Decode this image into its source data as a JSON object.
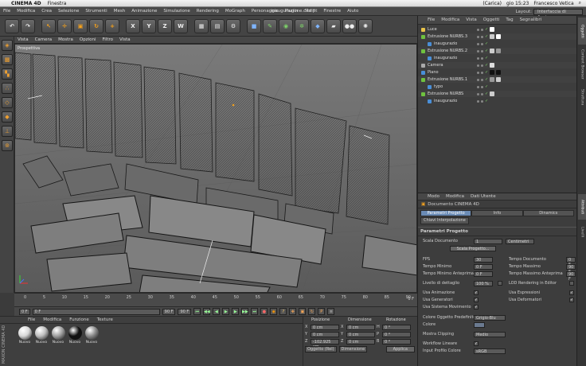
{
  "mac_menubar": {
    "app": "CINEMA 4D",
    "menu": "Finestra",
    "battery": "(Carica)",
    "clock": "gio 15:23",
    "user": "Francesco Vetica"
  },
  "window": {
    "title": "inaugurazione.c4d *"
  },
  "app_menu": [
    "File",
    "Modifica",
    "Crea",
    "Selezione",
    "Strumenti",
    "Mesh",
    "Animazione",
    "Simulazione",
    "Rendering",
    "MoGraph",
    "Personaggio",
    "Plugin",
    "Script",
    "Finestre",
    "Aiuto"
  ],
  "layout": {
    "label": "Layout:",
    "value": "Interfaccia di Avvio"
  },
  "toolbar": {
    "axis_x": "X",
    "axis_y": "Y",
    "axis_z": "Z",
    "world": "W"
  },
  "viewport": {
    "menu": [
      "Vista",
      "Camera",
      "Mostra",
      "Opzioni",
      "Filtro",
      "Vista"
    ],
    "label": "Prospettiva"
  },
  "timeline": {
    "ticks": [
      "0",
      "5",
      "10",
      "15",
      "20",
      "25",
      "30",
      "35",
      "40",
      "45",
      "50",
      "55",
      "60",
      "65",
      "70",
      "75",
      "80",
      "85",
      "90"
    ],
    "frame_end": "0 F"
  },
  "transport": {
    "start": "0 F",
    "current": "0 F",
    "end": "90 F",
    "end2": "90 F"
  },
  "material_panel": {
    "menu": [
      "File",
      "Modifica",
      "Funzione",
      "Texture"
    ],
    "brand": "MAXON CINEMA 4D",
    "materials": [
      {
        "name": "Nuovo",
        "color": "#d8d8d8"
      },
      {
        "name": "Nuovo",
        "color": "#bdbdbd"
      },
      {
        "name": "Nuovo",
        "color": "#a0a0a0"
      },
      {
        "name": "Nuovo",
        "color": "#111111"
      },
      {
        "name": "Nuovo",
        "color": "#8a8a8a"
      }
    ]
  },
  "coord_panel": {
    "headers": [
      "Posizione",
      "Dimensione",
      "Rotazione"
    ],
    "rows": [
      {
        "axis": "X",
        "pos": "0 cm",
        "dim": "0 cm",
        "rot_axis": "H",
        "rot": "0 °"
      },
      {
        "axis": "Y",
        "pos": "0 cm",
        "dim": "0 cm",
        "rot_axis": "P",
        "rot": "0 °"
      },
      {
        "axis": "Z",
        "pos": "-102.925 cm",
        "dim": "0 cm",
        "rot_axis": "B",
        "rot": "0 °"
      }
    ],
    "mode": "Oggetto (Rel)",
    "size_mode": "Dimensione",
    "apply": "Applica"
  },
  "object_manager": {
    "menu": [
      "File",
      "Modifica",
      "Vista",
      "Oggetti",
      "Tag",
      "Segnalibri"
    ],
    "objects": [
      {
        "name": "Luce",
        "indent": 0,
        "icon": "#e8c34a",
        "tags": [
          "#ffffff"
        ]
      },
      {
        "name": "Estrusione NURBS.3",
        "indent": 0,
        "icon": "#6fc23f",
        "tags": [
          "#cccccc",
          "#ffffff"
        ]
      },
      {
        "name": "inaugurazio",
        "indent": 1,
        "icon": "#4a8fd8",
        "tags": []
      },
      {
        "name": "Estrusione NURBS.2",
        "indent": 0,
        "icon": "#6fc23f",
        "tags": [
          "#cccccc",
          "#999999"
        ]
      },
      {
        "name": "inaugurazio",
        "indent": 1,
        "icon": "#4a8fd8",
        "tags": []
      },
      {
        "name": "Camera",
        "indent": 0,
        "icon": "#aaaaaa",
        "tags": [
          "#dddddd"
        ]
      },
      {
        "name": "Piano",
        "indent": 0,
        "icon": "#4a8fd8",
        "tags": [
          "#111111",
          "#111111"
        ]
      },
      {
        "name": "Estrusione NURBS.1",
        "indent": 0,
        "icon": "#6fc23f",
        "tags": [
          "#999999",
          "#cccccc"
        ]
      },
      {
        "name": "typo",
        "indent": 1,
        "icon": "#4a8fd8",
        "tags": []
      },
      {
        "name": "Estrusione NURBS",
        "indent": 0,
        "icon": "#6fc23f",
        "tags": [
          "#cccccc"
        ]
      },
      {
        "name": "inaugurazio",
        "indent": 1,
        "icon": "#4a8fd8",
        "tags": []
      }
    ]
  },
  "attributes": {
    "menu": [
      "Modo",
      "Modifica",
      "Dati Utente"
    ],
    "doc_title": "Documento CINEMA 4D",
    "tabs": [
      "Parametri Progetto",
      "Info",
      "Dinamics"
    ],
    "subtab": "Chiavi Interpolazione",
    "section": "Parametri Progetto",
    "scala_label": "Scala Documento",
    "scala_value": "1",
    "scala_unit": "Centimetri",
    "scala_button": "Scala Progetto...",
    "fps_label": "FPS",
    "fps": "30",
    "tempo_doc_label": "Tempo Documento",
    "tempo_doc": "0 F",
    "tempo_min_label": "Tempo Minimo",
    "tempo_min": "0 F",
    "tempo_max_label": "Tempo Massimo",
    "tempo_max": "90 F",
    "tempo_min_ant_label": "Tempo Minimo Anteprima",
    "tempo_min_ant": "0 F",
    "tempo_max_ant_label": "Tempo Massimo Anteprima",
    "tempo_max_ant": "90 F",
    "livello_label": "Livello di dettaglio",
    "livello": "100 %",
    "lod_label": "LOD Rendering in Editor",
    "usa_anim_label": "Usa Animazione",
    "usa_espr_label": "Usa Espressioni",
    "usa_gen_label": "Usa Generatori",
    "usa_def_label": "Usa Deformatori",
    "usa_sist_label": "Usa Sistema Movimento",
    "colore_pred_label": "Colore Oggetto Predefinito",
    "colore_pred": "Grigio-Blu",
    "colore_label": "Colore",
    "clipping_label": "Mostra Clipping",
    "clipping": "Medio",
    "workflow_label": "Workflow Lineare",
    "profilo_label": "Input Profilo Colore",
    "profilo": "sRGB",
    "check": "✓"
  },
  "side_tabs": [
    "Oggetti",
    "Content Browser",
    "Struttura",
    "Attributi",
    "Livelli"
  ]
}
